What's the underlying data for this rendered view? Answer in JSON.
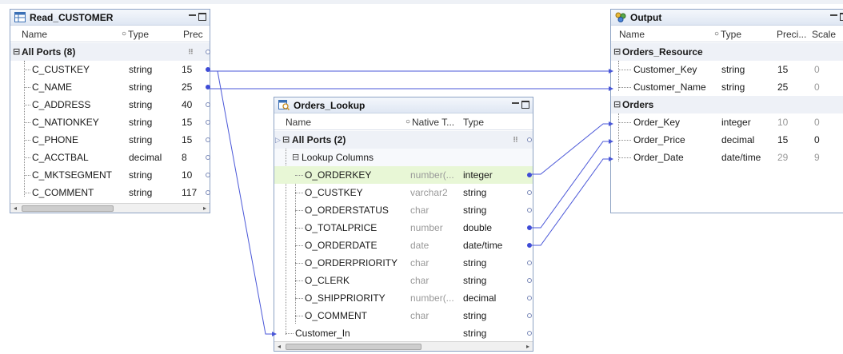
{
  "read_customer": {
    "title": "Read_CUSTOMER",
    "columns": {
      "name": "Name",
      "type": "Type",
      "prec": "Prec"
    },
    "group": "All Ports (8)",
    "rows": [
      {
        "name": "C_CUSTKEY",
        "type": "string",
        "prec": "15"
      },
      {
        "name": "C_NAME",
        "type": "string",
        "prec": "25"
      },
      {
        "name": "C_ADDRESS",
        "type": "string",
        "prec": "40"
      },
      {
        "name": "C_NATIONKEY",
        "type": "string",
        "prec": "15"
      },
      {
        "name": "C_PHONE",
        "type": "string",
        "prec": "15"
      },
      {
        "name": "C_ACCTBAL",
        "type": "decimal",
        "prec": "8"
      },
      {
        "name": "C_MKTSEGMENT",
        "type": "string",
        "prec": "10"
      },
      {
        "name": "C_COMMENT",
        "type": "string",
        "prec": "117"
      }
    ]
  },
  "orders_lookup": {
    "title": "Orders_Lookup",
    "columns": {
      "name": "Name",
      "native_type": "Native T...",
      "type": "Type"
    },
    "group": "All Ports (2)",
    "subgroup": "Lookup Columns",
    "rows": [
      {
        "name": "O_ORDERKEY",
        "native": "number(...",
        "type": "integer"
      },
      {
        "name": "O_CUSTKEY",
        "native": "varchar2",
        "type": "string"
      },
      {
        "name": "O_ORDERSTATUS",
        "native": "char",
        "type": "string"
      },
      {
        "name": "O_TOTALPRICE",
        "native": "number",
        "type": "double"
      },
      {
        "name": "O_ORDERDATE",
        "native": "date",
        "type": "date/time"
      },
      {
        "name": "O_ORDERPRIORITY",
        "native": "char",
        "type": "string"
      },
      {
        "name": "O_CLERK",
        "native": "char",
        "type": "string"
      },
      {
        "name": "O_SHIPPRIORITY",
        "native": "number(...",
        "type": "decimal"
      },
      {
        "name": "O_COMMENT",
        "native": "char",
        "type": "string"
      }
    ],
    "input_row": {
      "name": "Customer_In",
      "type": "string"
    }
  },
  "output": {
    "title": "Output",
    "columns": {
      "name": "Name",
      "type": "Type",
      "prec": "Preci...",
      "scale": "Scale"
    },
    "groups": [
      {
        "label": "Orders_Resource",
        "rows": [
          {
            "name": "Customer_Key",
            "type": "string",
            "prec": "15",
            "scale": "0"
          },
          {
            "name": "Customer_Name",
            "type": "string",
            "prec": "25",
            "scale": "0"
          }
        ]
      },
      {
        "label": "Orders",
        "rows": [
          {
            "name": "Order_Key",
            "type": "integer",
            "prec": "10",
            "scale": "0"
          },
          {
            "name": "Order_Price",
            "type": "decimal",
            "prec": "15",
            "scale": "0"
          },
          {
            "name": "Order_Date",
            "type": "date/time",
            "prec": "29",
            "scale": "9"
          }
        ]
      }
    ]
  },
  "colors": {
    "link": "#4a57d8",
    "border": "#8ea3c4",
    "highlight": "#e8f7d6"
  }
}
